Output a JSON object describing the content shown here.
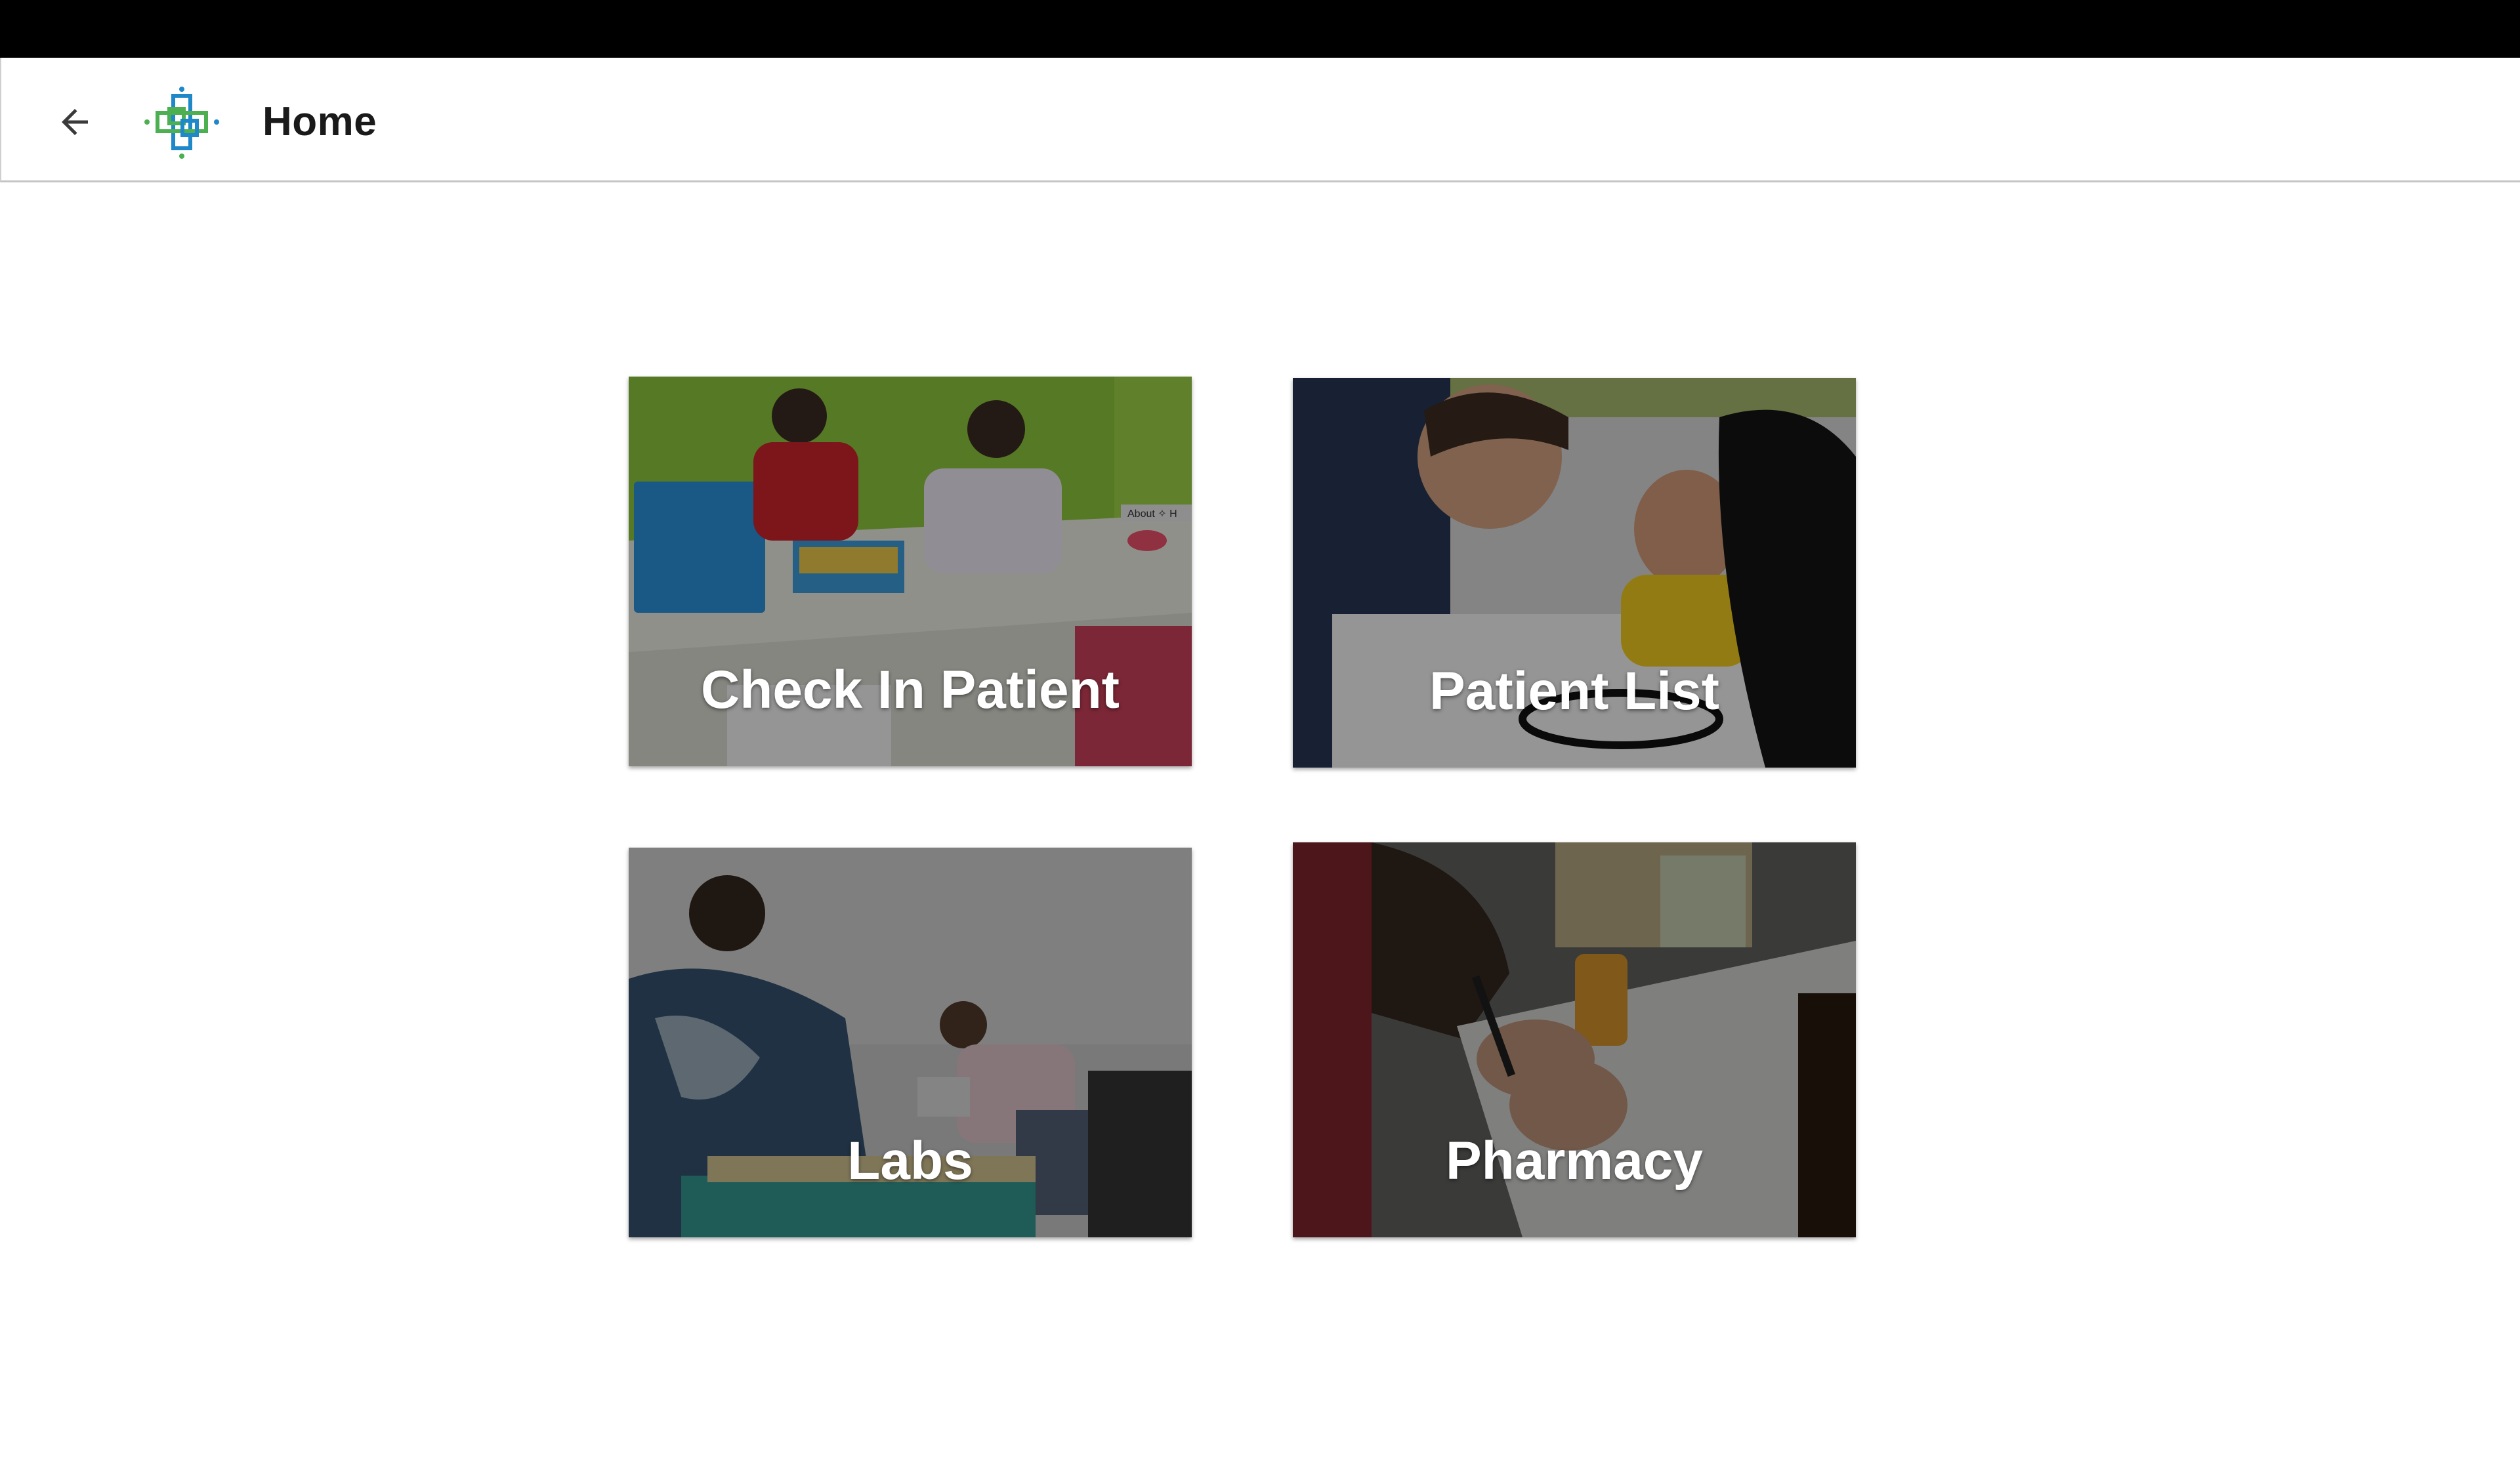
{
  "app_bar": {
    "title": "Home",
    "back_icon": "arrow-left-icon",
    "logo_icon": "medical-cross-logo-icon"
  },
  "tiles": [
    {
      "label": "Check In Patient",
      "image": "clinic-reception-photo"
    },
    {
      "label": "Patient List",
      "image": "doctor-with-child-photo"
    },
    {
      "label": "Labs",
      "image": "lab-workers-photo"
    },
    {
      "label": "Pharmacy",
      "image": "prescription-writing-photo"
    }
  ],
  "photo_sign": "About ✧ H",
  "colors": {
    "status_bar": "#000000",
    "app_bar": "#ffffff",
    "logo_green": "#4caf50",
    "logo_blue": "#1e88c8",
    "tile_label": "#ffffff"
  }
}
